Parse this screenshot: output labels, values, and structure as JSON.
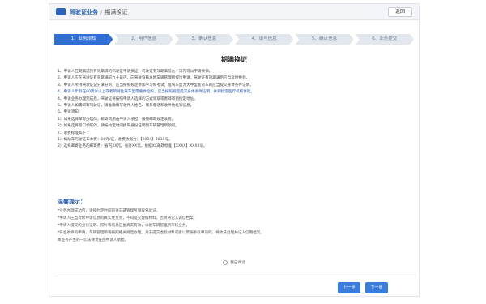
{
  "header": {
    "system_name": "驾驶证业务",
    "separator": "/",
    "breadcrumb": "期满换证",
    "back_label": "返回"
  },
  "steps": [
    {
      "label": "1、业务须知",
      "active": true
    },
    {
      "label": "2、用户信息",
      "active": false
    },
    {
      "label": "3、确认信息",
      "active": false
    },
    {
      "label": "4、填写信息",
      "active": false
    },
    {
      "label": "5、确认信息",
      "active": false
    },
    {
      "label": "6、业务提交",
      "active": false
    }
  ],
  "notice_title": "期满换证",
  "notice_lines": [
    "1、申请人在期满前持有效期满的驾驶证申请换证，驾驶证有效期满前九十日内可以申请换领。",
    "2、申请人应在驾驶证有效期满前九十日内，向驾驶证核发地车辆管理所提出申请，驾驶证有效期满后应当及时换领。",
    "3、申请人所持驾驶证记分满分的，应当按照规定参加学习和考试；准驾车型为大中型客货车的应当提交身体条件证明。",
    "4、申请人年龄在60周岁以上或者所持准驾车型需要体检的，应当按照规定提交身体条件证明，并到指定医疗机构体检。",
    "4、申请业务办理完成后，驾驶证将按照申请人选择的方式领取或者邮寄到指定地址。",
    "5、申请人如需邮寄驾驶证，请准确填写收件人姓名、联系电话和收件地址等信息。",
    "6、申请须知：",
    "1）如果选择邮寄办理的，邮寄费用由申请人承担，按照邮政规定收费。",
    "2）如果选择窗口领取的，请按约定时间携带身份证明到车辆管理所领取。",
    "7、收费标准如下：",
    "1）机动车驾驶证工本费：10元/证，收费依据为：【2004】2831号。",
    "2）选择邮寄业务的邮寄费：省内XX元，省外XX元，依据XX邮政标准【XXXX】XXXX号。"
  ],
  "highlighted_line_index": 3,
  "tips": {
    "title": "温馨提示：",
    "lines": [
      "*业务办理成功后，请按约定时间前往车辆管理所领取驾驶证。",
      "*申请人应当对所申请信息的真实性负责，不得提交虚假材料，否则将记入诚信档案。",
      "*申请人提交的身份证明、照片等信息应当真实有效，以便车辆管理所审核业务。",
      "*符合条件的申请，车辆管理所将按照相关规定办理，对于提交虚假材料或者以欺骗手段申请的，将依法处理并记入信用档案。",
      "本业务产生的一切法律责任由申请人承担。"
    ]
  },
  "agree_label": "我已阅读",
  "buttons": {
    "prev": "上一步",
    "next": "下一步"
  },
  "colors": {
    "accent": "#2f6fd1",
    "button": "#3b7ddd",
    "highlight_text": "#2a5db0"
  }
}
